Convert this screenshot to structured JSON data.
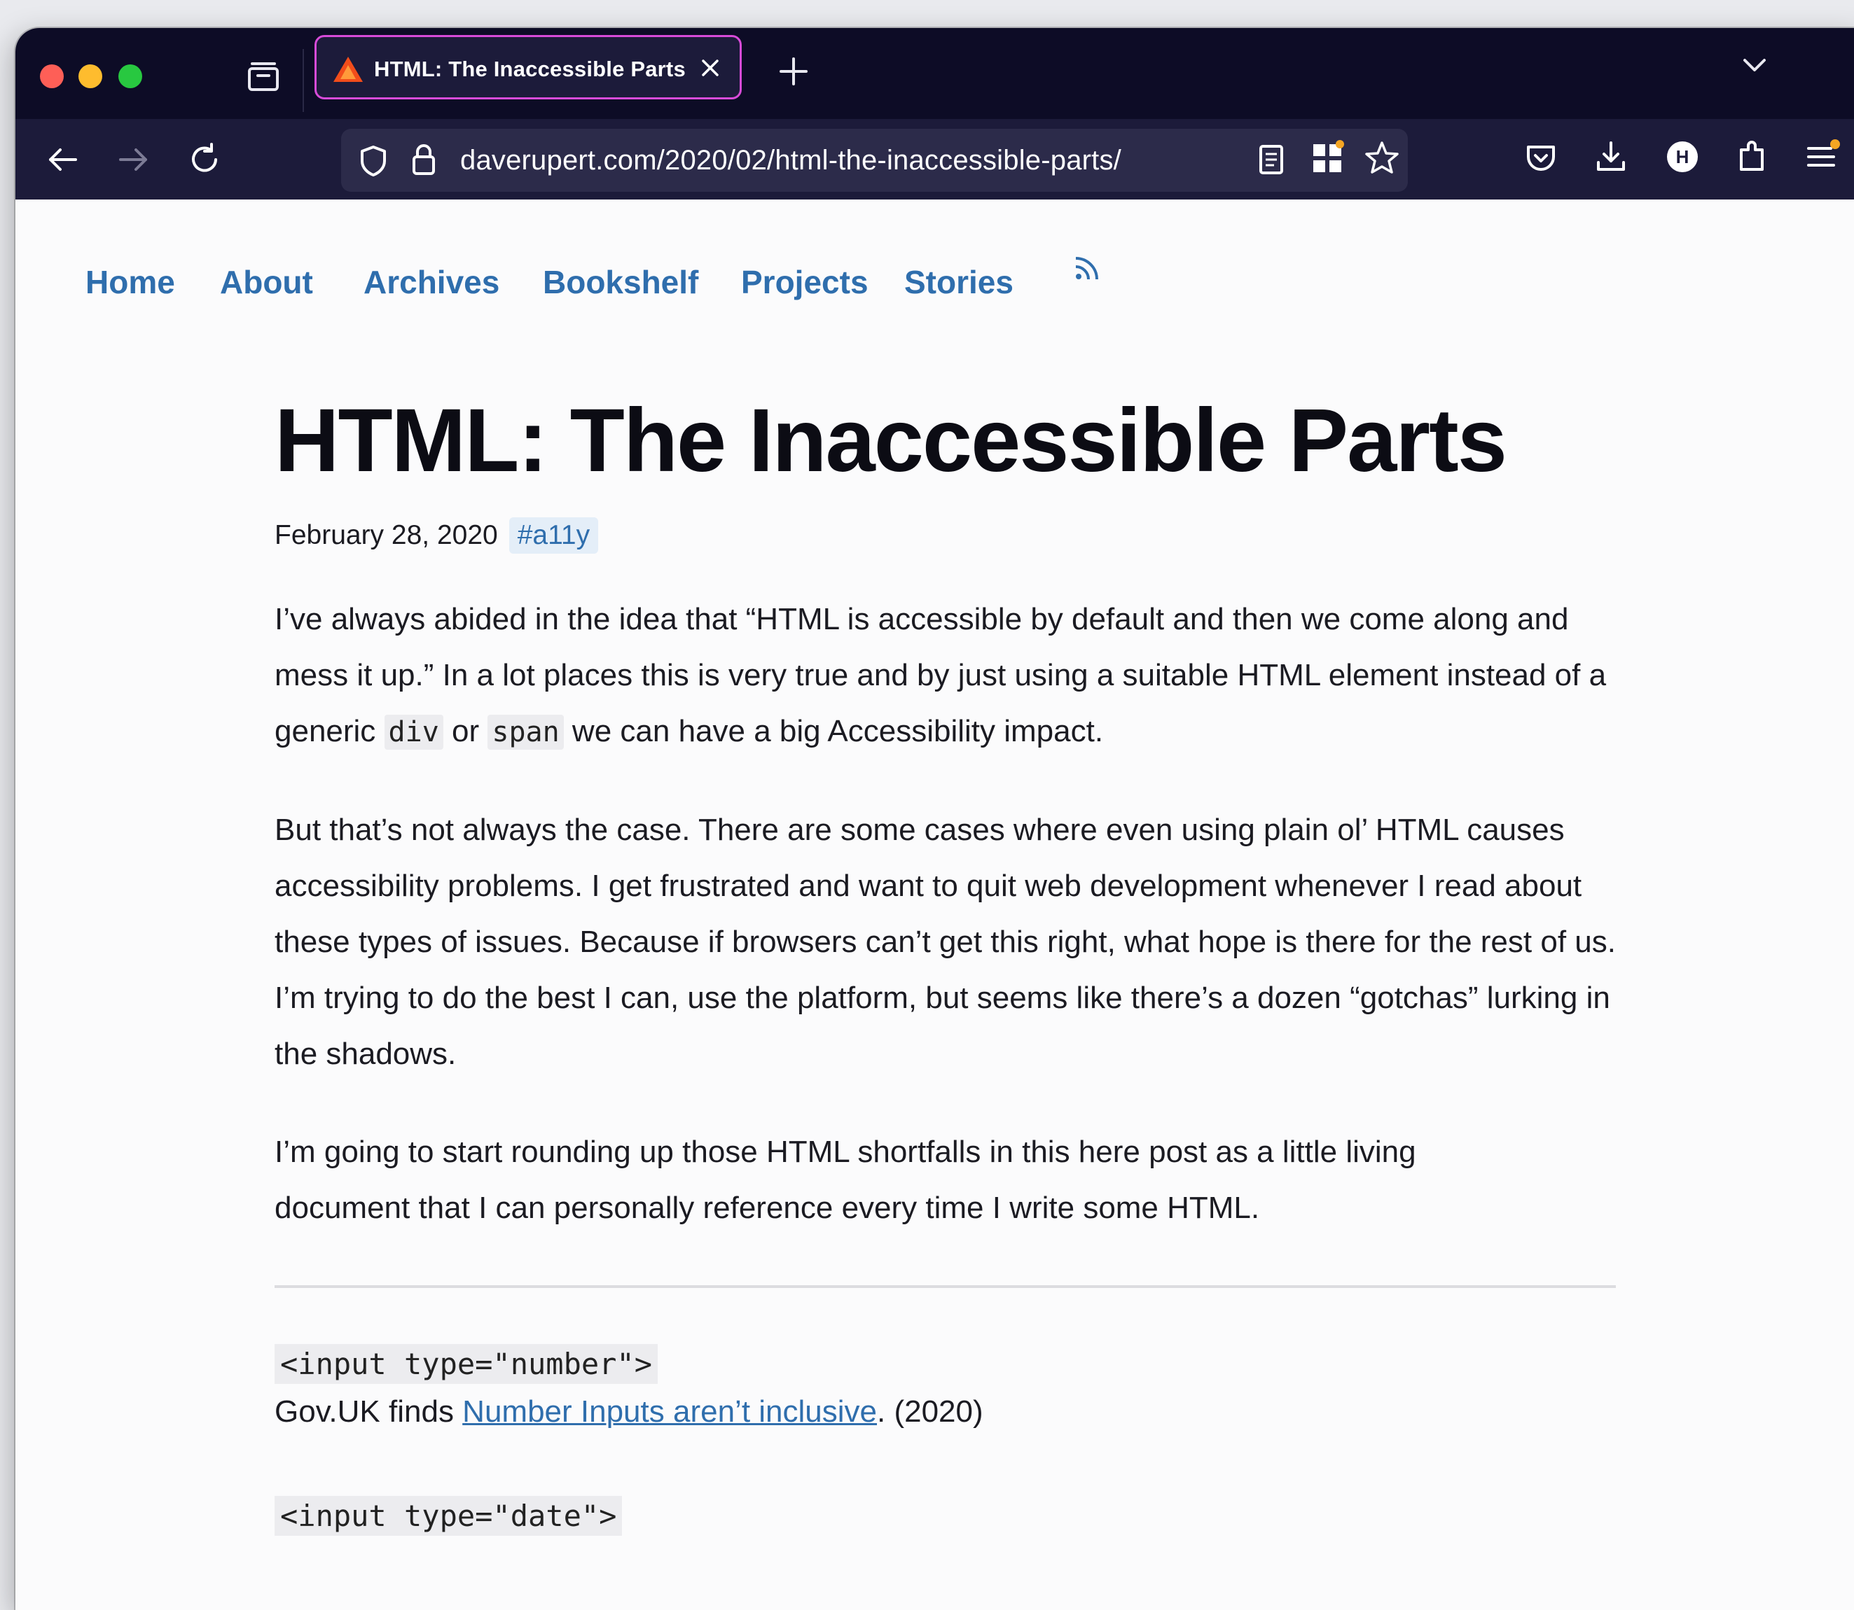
{
  "browser": {
    "tab_title": "HTML: The Inaccessible Parts -",
    "url": "daverupert.com/2020/02/html-the-inaccessible-parts/",
    "colors": {
      "chrome": "#0d0c26",
      "toolbar": "#1c1b3a",
      "tab_outline": "#d74bd8"
    }
  },
  "site_nav": {
    "items": [
      "Home",
      "About",
      "Archives",
      "Bookshelf",
      "Projects",
      "Stories"
    ],
    "rss_icon": "rss-icon"
  },
  "article": {
    "title": "HTML: The Inaccessible Parts",
    "date": "February 28, 2020",
    "tag": "#a11y",
    "p1": {
      "before_div": "I’ve always abided in the idea that “HTML is accessible by default and then we come along and mess it up.” In a lot places this is very true and by just using a suitable HTML element instead of a generic ",
      "code_div": "div",
      "or": " or ",
      "code_span": "span",
      "after_span": " we can have a big Accessibility impact."
    },
    "p2": "But that’s not always the case. There are some cases where even using plain ol’ HTML causes accessibility problems. I get frustrated and want to quit web development whenever I read about these types of issues. Because if browsers can’t get this right, what hope is there for the rest of us. I’m trying to do the best I can, use the platform, but seems like there’s a dozen “gotchas” lurking in the shadows.",
    "p3": "I’m going to start rounding up those HTML shortfalls in this here post as a little living document that I can personally reference every time I write some HTML.",
    "entries": [
      {
        "code": "<input type=\"number\">",
        "desc_before": "Gov.UK finds ",
        "link": "Number Inputs aren’t inclusive",
        "desc_after": ". (2020)"
      },
      {
        "code": "<input type=\"date\">"
      }
    ]
  },
  "colors": {
    "link": "#2f6ead",
    "text": "#1b1b22",
    "heading": "#0c0c14"
  }
}
